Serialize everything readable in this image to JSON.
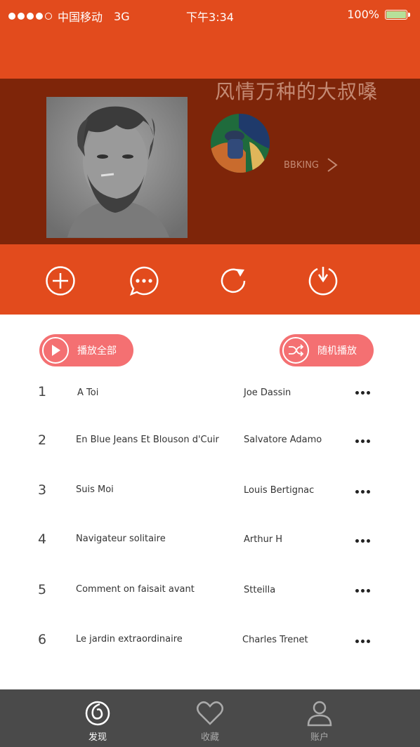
{
  "status_bar": {
    "carrier": "中国移动",
    "network": "3G",
    "time": "下午3:34",
    "battery": "100%"
  },
  "playlist": {
    "title": "风情万种的大叔嗓",
    "creator_name": "BBKING"
  },
  "actions": [
    {
      "icon": "add-icon"
    },
    {
      "icon": "comment-icon"
    },
    {
      "icon": "share-icon"
    },
    {
      "icon": "download-icon"
    }
  ],
  "controls": {
    "play_all_label": "播放全部",
    "shuffle_label": "随机播放"
  },
  "songs": [
    {
      "number": "1",
      "title": "A Toi",
      "artist": "Joe Dassin"
    },
    {
      "number": "2",
      "title": "En Blue Jeans Et Blouson d'Cuir",
      "artist": "Salvatore Adamo"
    },
    {
      "number": "3",
      "title": "Suis Moi",
      "artist": "Louis Bertignac"
    },
    {
      "number": "4",
      "title": "Navigateur solitaire",
      "artist": "Arthur H"
    },
    {
      "number": "5",
      "title": "Comment on faisait avant",
      "artist": "Stteilla"
    },
    {
      "number": "6",
      "title": "Le jardin extraordinaire",
      "artist": "Charles Trenet"
    }
  ],
  "tabs": [
    {
      "label": "发现",
      "icon": "discover-icon",
      "active": true
    },
    {
      "label": "收藏",
      "icon": "heart-icon",
      "active": false
    },
    {
      "label": "账户",
      "icon": "user-icon",
      "active": false
    }
  ],
  "colors": {
    "primary": "#e24b1d",
    "hero_bg": "#7e2509",
    "pill": "#f47072",
    "tab_bar": "#4a4a4a"
  }
}
